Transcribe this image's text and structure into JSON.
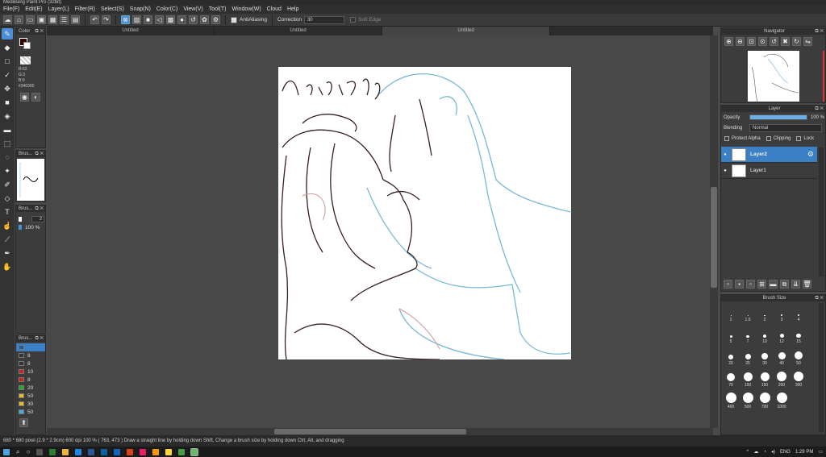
{
  "window": {
    "title": "MediBang Paint Pro (32bit)"
  },
  "menu": [
    "File(F)",
    "Edit(E)",
    "Layer(L)",
    "Filter(R)",
    "Select(S)",
    "Snap(N)",
    "Color(C)",
    "View(V)",
    "Tool(T)",
    "Window(W)",
    "Cloud",
    "Help"
  ],
  "toolbar": {
    "antialias_label": "AntiAliasing",
    "correction_label": "Correction",
    "correction_value": "30",
    "soft_edge_label": "Soft Edge"
  },
  "tabs": [
    "Untitled",
    "Untitled",
    "Untitled"
  ],
  "color_panel": {
    "title": "Color",
    "r": "R:52",
    "g": "G:3",
    "b": "B:0",
    "hex": "#340300",
    "primary_color": "#340300"
  },
  "brush_preview_panel": {
    "title": "Brus..."
  },
  "brush_settings_panel": {
    "title": "Brus...",
    "size": "2",
    "opacity": "100 %"
  },
  "brush_list_panel": {
    "title": "Brus...",
    "items": [
      {
        "value": "",
        "color": "#1e5a9e"
      },
      {
        "value": "8",
        "color": "#333333"
      },
      {
        "value": "8",
        "color": "#333333"
      },
      {
        "value": "10",
        "color": "#cc2222"
      },
      {
        "value": "8",
        "color": "#cc2222"
      },
      {
        "value": "20",
        "color": "#22aa22"
      },
      {
        "value": "50",
        "color": "#e0c020"
      },
      {
        "value": "30",
        "color": "#e0c020"
      },
      {
        "value": "50",
        "color": "#40b0e0"
      }
    ]
  },
  "canvas": {
    "handwriting": "ko-thire f, thank"
  },
  "navigator": {
    "title": "Navigator"
  },
  "layer_panel": {
    "title": "Layer",
    "opacity_label": "Opacity",
    "opacity_value": "100 %",
    "blending_label": "Blending",
    "blending_value": "Normal",
    "protect_alpha": "Protect Alpha",
    "clipping": "Clipping",
    "lock": "Lock",
    "layers": [
      {
        "name": "Layer2",
        "selected": true
      },
      {
        "name": "Layer1",
        "selected": false
      }
    ]
  },
  "brush_size_panel": {
    "title": "Brush Size",
    "sizes": [
      "1",
      "1.5",
      "2",
      "3",
      "4",
      "5",
      "7",
      "10",
      "12",
      "15",
      "20",
      "25",
      "30",
      "40",
      "50",
      "70",
      "100",
      "150",
      "200",
      "300",
      "400",
      "500",
      "700",
      "1000"
    ]
  },
  "status": {
    "text": "680 * 680 pixel  (2.9 * 2.9cm)  600 dpi  100 %  ( 763, 473 )  Draw a straight line by holding down Shift, Change a brush size by holding down Ctrl, Alt, and dragging"
  },
  "taskbar": {
    "lang": "ENG",
    "time": "1:29 PM"
  }
}
